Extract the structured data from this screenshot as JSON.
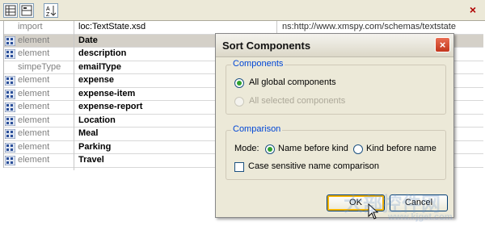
{
  "toolbar": {
    "buttons": [
      "grid-view-icon",
      "split-view-icon",
      "sort-icon"
    ],
    "close": "×"
  },
  "grid": {
    "rows": [
      {
        "icon": false,
        "type": "import",
        "name": "loc:TextState.xsd",
        "bold": false,
        "ns": "ns:http://www.xmspy.com/schemas/textstate"
      },
      {
        "icon": true,
        "type": "element",
        "name": "Date",
        "bold": true,
        "selected": true
      },
      {
        "icon": true,
        "type": "element",
        "name": "description",
        "bold": true
      },
      {
        "icon": false,
        "type": "simpeType",
        "name": "emailType",
        "bold": true
      },
      {
        "icon": true,
        "type": "element",
        "name": "expense",
        "bold": true
      },
      {
        "icon": true,
        "type": "element",
        "name": "expense-item",
        "bold": true
      },
      {
        "icon": true,
        "type": "element",
        "name": "expense-report",
        "bold": true
      },
      {
        "icon": true,
        "type": "element",
        "name": "Location",
        "bold": true
      },
      {
        "icon": true,
        "type": "element",
        "name": "Meal",
        "bold": true
      },
      {
        "icon": true,
        "type": "element",
        "name": "Parking",
        "bold": true
      },
      {
        "icon": true,
        "type": "element",
        "name": "Travel",
        "bold": true
      }
    ]
  },
  "dialog": {
    "title": "Sort Components",
    "close": "×",
    "components": {
      "label": "Components",
      "options": [
        {
          "label": "All global components",
          "checked": true,
          "enabled": true
        },
        {
          "label": "All selected components",
          "checked": false,
          "enabled": false
        }
      ]
    },
    "comparison": {
      "label": "Comparison",
      "mode_label": "Mode:",
      "modes": [
        {
          "label": "Name before kind",
          "checked": true
        },
        {
          "label": "Kind before name",
          "checked": false
        }
      ],
      "case_label": "Case sensitive name comparison",
      "case_checked": false
    },
    "ok": "OK",
    "cancel": "Cancel"
  },
  "watermark": {
    "text": "大部控件网",
    "sub": "www.kjget.com"
  },
  "colors": {
    "accent": "#0046d5",
    "selected_row": "#d4d0c8",
    "dialog_bg": "#ece9d8"
  }
}
